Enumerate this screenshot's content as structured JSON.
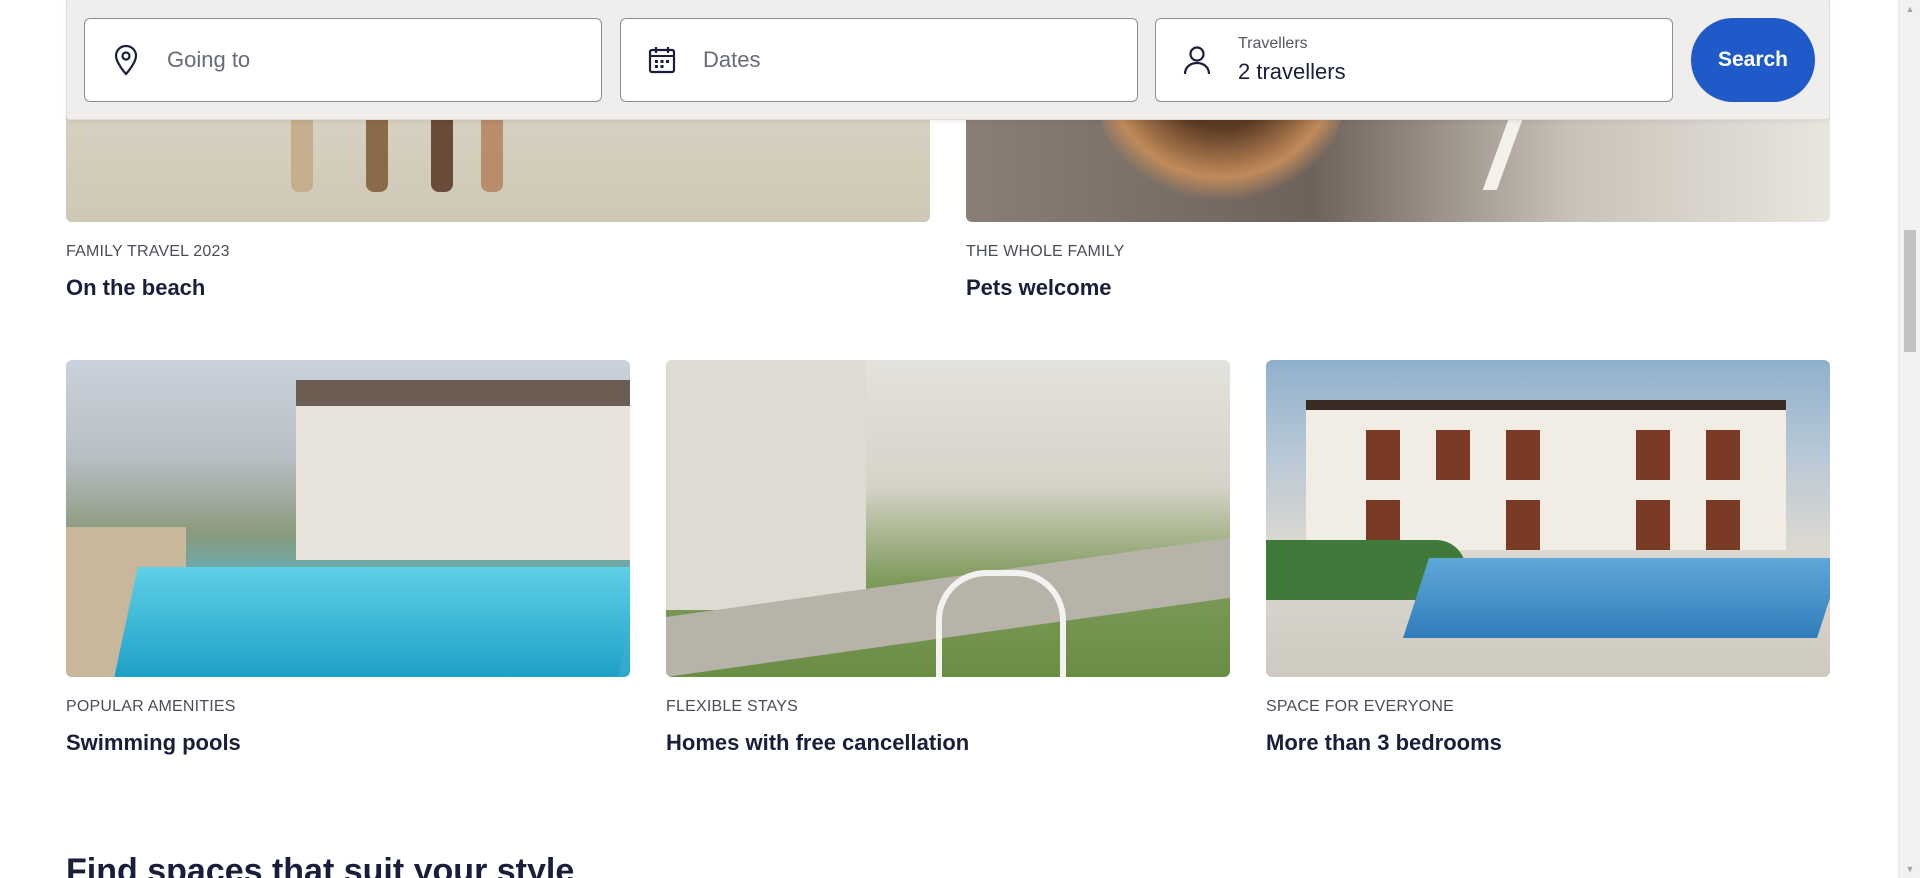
{
  "search": {
    "destination_placeholder": "Going to",
    "dates_placeholder": "Dates",
    "travellers_label": "Travellers",
    "travellers_value": "2 travellers",
    "search_label": "Search",
    "accent_color": "#1f5ac8"
  },
  "cards_top": [
    {
      "eyebrow": "FAMILY TRAVEL 2023",
      "title": "On the beach"
    },
    {
      "eyebrow": "THE WHOLE FAMILY",
      "title": "Pets welcome"
    }
  ],
  "cards_middle": [
    {
      "eyebrow": "POPULAR AMENITIES",
      "title": "Swimming pools"
    },
    {
      "eyebrow": "FLEXIBLE STAYS",
      "title": "Homes with free cancellation"
    },
    {
      "eyebrow": "SPACE FOR EVERYONE",
      "title": "More than 3 bedrooms"
    }
  ],
  "section": {
    "heading": "Find spaces that suit your style"
  }
}
